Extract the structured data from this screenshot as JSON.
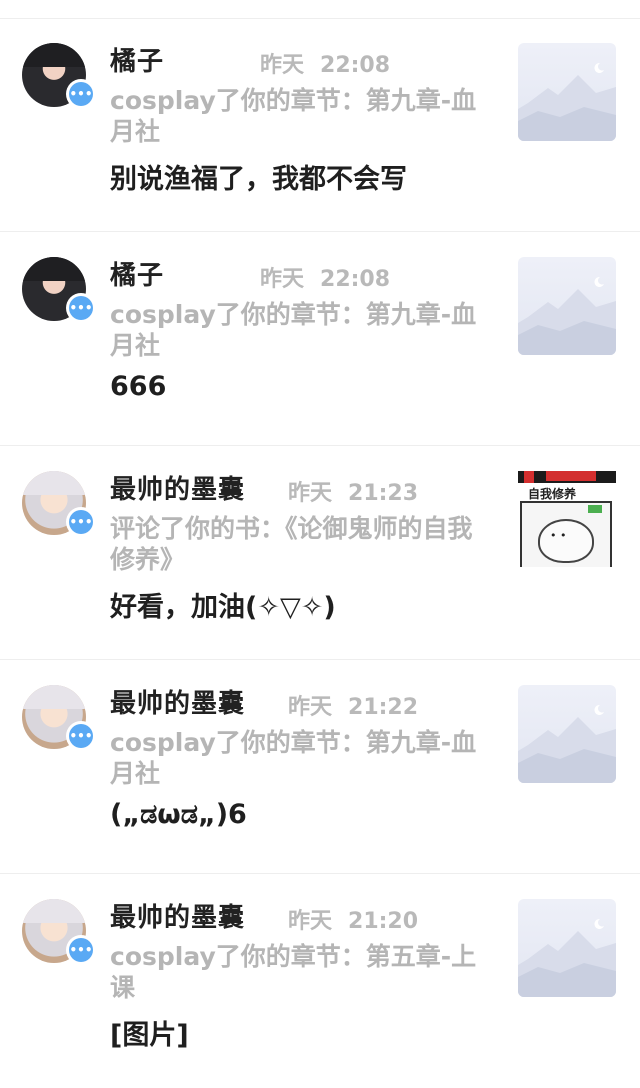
{
  "notifications": [
    {
      "name": "橘子",
      "name_full": "橘子",
      "time": "昨天",
      "time_clock": "22:08",
      "subtitle": "cosplay了你的章节：第九章-血月社",
      "content": "别说渔福了，我都不会写",
      "avatar": "avatar-dark",
      "thumb": "mountain-placeholder-icon"
    },
    {
      "name": "橘子",
      "time": "昨天",
      "time_clock": "22:08",
      "subtitle": "cosplay了你的章节：第九章-血月社",
      "content": "666",
      "avatar": "avatar-dark",
      "thumb": "mountain-placeholder-icon"
    },
    {
      "name": "最帅的墨囊",
      "time": "昨天",
      "time_clock": "21:23",
      "subtitle": "评论了你的书：《论御鬼师的自我修养》",
      "content": "好看，加油(✧▽✧)",
      "avatar": "avatar-light",
      "thumb": "book-cover-photo",
      "thumb_label": "自我修养"
    },
    {
      "name": "最帅的墨囊",
      "time": "昨天",
      "time_clock": "21:22",
      "subtitle": "cosplay了你的章节：第九章-血月社",
      "content": "(„ಡωಡ„)6",
      "avatar": "avatar-light",
      "thumb": "mountain-placeholder-icon"
    },
    {
      "name": "最帅的墨囊",
      "time": "昨天",
      "time_clock": "21:20",
      "subtitle": "cosplay了你的章节：第五章-上课",
      "content": "[图片]",
      "avatar": "avatar-light",
      "thumb": "mountain-placeholder-icon"
    }
  ],
  "badge_icon": "chat-bubble-icon",
  "colors": {
    "name": "#222222",
    "muted": "#b5b5b5",
    "badge": "#5aa9f4",
    "divider": "#eeeeee"
  }
}
